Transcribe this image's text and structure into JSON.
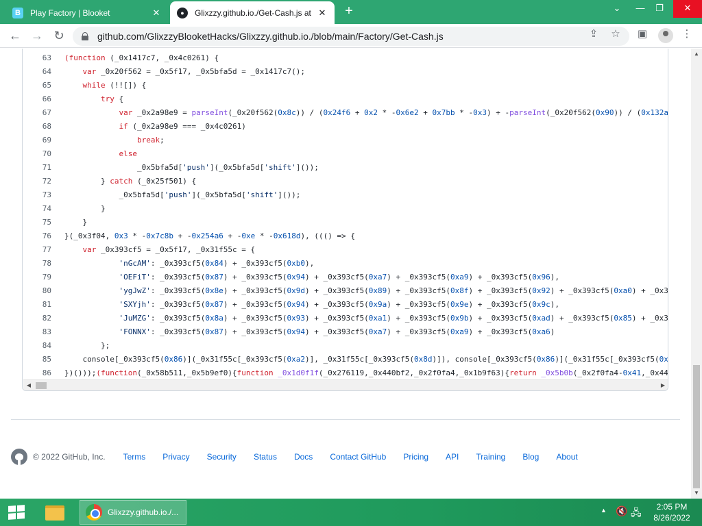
{
  "tabs": [
    {
      "title": "Play Factory | Blooket",
      "favicon": "B"
    },
    {
      "title": "Glixzzy.github.io./Get-Cash.js at",
      "favicon": "GH"
    }
  ],
  "addressbar": {
    "url": "github.com/GlixzzyBlooketHacks/Glixzzy.github.io./blob/main/Factory/Get-Cash.js"
  },
  "code_lines": [
    {
      "num": "63",
      "html": "<span class='k'>(function</span> (_0x1417c7, _0x4c0261) {"
    },
    {
      "num": "64",
      "html": "    <span class='k'>var</span> _0x20f562 = _0x5f17, _0x5bfa5d = _0x1417c7();"
    },
    {
      "num": "65",
      "html": "    <span class='k'>while</span> (!![]) {"
    },
    {
      "num": "66",
      "html": "        <span class='k'>try</span> {"
    },
    {
      "num": "67",
      "html": "            <span class='k'>var</span> _0x2a98e9 = <span class='f'>parseInt</span>(_0x20f562(<span class='n'>0x8c</span>)) / (<span class='n'>0x24f6</span> + <span class='n'>0x2</span> * -<span class='n'>0x6e2</span> + <span class='n'>0x7bb</span> * -<span class='n'>0x3</span>) + -<span class='f'>parseInt</span>(_0x20f562(<span class='n'>0x90</span>)) / (<span class='n'>0x132a</span>"
    },
    {
      "num": "68",
      "html": "            <span class='k'>if</span> (_0x2a98e9 === _0x4c0261)"
    },
    {
      "num": "69",
      "html": "                <span class='k'>break</span>;"
    },
    {
      "num": "70",
      "html": "            <span class='k'>else</span>"
    },
    {
      "num": "71",
      "html": "                _0x5bfa5d[<span class='s'>'push'</span>](_0x5bfa5d[<span class='s'>'shift'</span>]());"
    },
    {
      "num": "72",
      "html": "        } <span class='k'>catch</span> (_0x25f501) {"
    },
    {
      "num": "73",
      "html": "            _0x5bfa5d[<span class='s'>'push'</span>](_0x5bfa5d[<span class='s'>'shift'</span>]());"
    },
    {
      "num": "74",
      "html": "        }"
    },
    {
      "num": "75",
      "html": "    }"
    },
    {
      "num": "76",
      "html": "}(_0x3f04, <span class='n'>0x3</span> * -<span class='n'>0x7c8b</span> + -<span class='n'>0x254a6</span> + -<span class='n'>0xe</span> * -<span class='n'>0x618d</span>), ((() => {"
    },
    {
      "num": "77",
      "html": "    <span class='k'>var</span> _0x393cf5 = _0x5f17, _0x31f55c = {"
    },
    {
      "num": "78",
      "html": "            <span class='s'>'nGcAM'</span>: _0x393cf5(<span class='n'>0x84</span>) + _0x393cf5(<span class='n'>0xb0</span>),"
    },
    {
      "num": "79",
      "html": "            <span class='s'>'OEFiT'</span>: _0x393cf5(<span class='n'>0x87</span>) + _0x393cf5(<span class='n'>0x94</span>) + _0x393cf5(<span class='n'>0xa7</span>) + _0x393cf5(<span class='n'>0xa9</span>) + _0x393cf5(<span class='n'>0x96</span>),"
    },
    {
      "num": "80",
      "html": "            <span class='s'>'ygJwZ'</span>: _0x393cf5(<span class='n'>0x8e</span>) + _0x393cf5(<span class='n'>0x9d</span>) + _0x393cf5(<span class='n'>0x89</span>) + _0x393cf5(<span class='n'>0x8f</span>) + _0x393cf5(<span class='n'>0x92</span>) + _0x393cf5(<span class='n'>0xa0</span>) + _0x39"
    },
    {
      "num": "81",
      "html": "            <span class='s'>'SXYjh'</span>: _0x393cf5(<span class='n'>0x87</span>) + _0x393cf5(<span class='n'>0x94</span>) + _0x393cf5(<span class='n'>0x9a</span>) + _0x393cf5(<span class='n'>0x9e</span>) + _0x393cf5(<span class='n'>0x9c</span>),"
    },
    {
      "num": "82",
      "html": "            <span class='s'>'JuMZG'</span>: _0x393cf5(<span class='n'>0x8a</span>) + _0x393cf5(<span class='n'>0x93</span>) + _0x393cf5(<span class='n'>0xa1</span>) + _0x393cf5(<span class='n'>0x9b</span>) + _0x393cf5(<span class='n'>0xad</span>) + _0x393cf5(<span class='n'>0x85</span>) + _0x39"
    },
    {
      "num": "83",
      "html": "            <span class='s'>'FONNX'</span>: _0x393cf5(<span class='n'>0x87</span>) + _0x393cf5(<span class='n'>0x94</span>) + _0x393cf5(<span class='n'>0xa7</span>) + _0x393cf5(<span class='n'>0xa9</span>) + _0x393cf5(<span class='n'>0xa6</span>)"
    },
    {
      "num": "84",
      "html": "        };"
    },
    {
      "num": "85",
      "html": "    console[_0x393cf5(<span class='n'>0x86</span>)](_0x31f55c[_0x393cf5(<span class='n'>0xa2</span>)], _0x31f55c[_0x393cf5(<span class='n'>0x8d</span>)]), console[_0x393cf5(<span class='n'>0x86</span>)](_0x31f55c[_0x393cf5(<span class='n'>0x8</span>"
    },
    {
      "num": "86",
      "html": "})()));<span class='k'>(function</span>(_0x58b511,_0x5b9ef0){<span class='k'>function</span> <span class='f'>_0x1d0f1f</span>(_0x276119,_0x440bf2,_0x2f0fa4,_0x1b9f63){<span class='k'>return</span> <span class='f'>_0x5b0b</span>(_0x2f0fa4-<span class='n'>0x41</span>,_0x44"
    }
  ],
  "footer": {
    "copyright": "© 2022 GitHub, Inc.",
    "links": [
      "Terms",
      "Privacy",
      "Security",
      "Status",
      "Docs",
      "Contact GitHub",
      "Pricing",
      "API",
      "Training",
      "Blog",
      "About"
    ]
  },
  "taskbar": {
    "chrome_label": "Glixzzy.github.io./...",
    "time": "2:05 PM",
    "date": "8/26/2022"
  },
  "colors": {
    "accent": "#2ea672",
    "link": "#0969da",
    "keyword": "#cf222e"
  },
  "icons": [
    "back-icon",
    "forward-icon",
    "reload-icon",
    "lock-icon",
    "share-icon",
    "star-icon",
    "sidepanel-icon",
    "profile-icon",
    "kebab-menu-icon"
  ]
}
